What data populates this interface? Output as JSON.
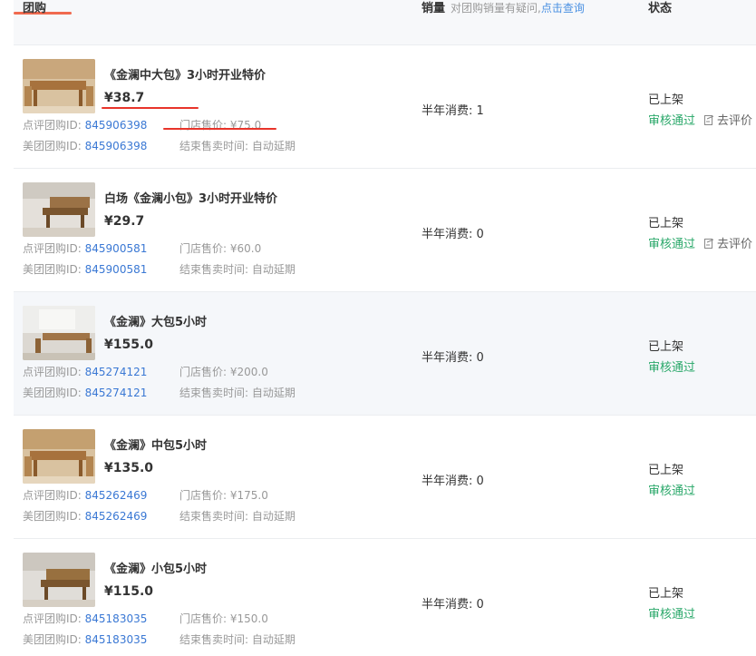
{
  "header": {
    "deal_label": "团购",
    "sales_label": "销量",
    "sales_hint": "对团购销量有疑问,",
    "sales_hint_link": "点击查询",
    "status_label": "状态"
  },
  "labels": {
    "dianping_id": "点评团购ID: ",
    "meituan_id": "美团团购ID: ",
    "store_price": "门店售价: ",
    "end_time": "结束售卖时间: ",
    "half_year": "半年消费: "
  },
  "rows": [
    {
      "title": "《金澜中大包》3小时开业特价",
      "price": "¥38.7",
      "dianping_id": "845906398",
      "meituan_id": "845906398",
      "store_price": "¥75.0",
      "end_time": "自动延期",
      "sales": "1",
      "status": "已上架",
      "review_status": "审核通过",
      "review_action": "去评价"
    },
    {
      "title": "白场《金澜小包》3小时开业特价",
      "price": "¥29.7",
      "dianping_id": "845900581",
      "meituan_id": "845900581",
      "store_price": "¥60.0",
      "end_time": "自动延期",
      "sales": "0",
      "status": "已上架",
      "review_status": "审核通过",
      "review_action": "去评价"
    },
    {
      "title": "《金澜》大包5小时",
      "price": "¥155.0",
      "dianping_id": "845274121",
      "meituan_id": "845274121",
      "store_price": "¥200.0",
      "end_time": "自动延期",
      "sales": "0",
      "status": "已上架",
      "review_status": "审核通过"
    },
    {
      "title": "《金澜》中包5小时",
      "price": "¥135.0",
      "dianping_id": "845262469",
      "meituan_id": "845262469",
      "store_price": "¥175.0",
      "end_time": "自动延期",
      "sales": "0",
      "status": "已上架",
      "review_status": "审核通过"
    },
    {
      "title": "《金澜》小包5小时",
      "price": "¥115.0",
      "dianping_id": "845183035",
      "meituan_id": "845183035",
      "store_price": "¥150.0",
      "end_time": "自动延期",
      "sales": "0",
      "status": "已上架",
      "review_status": "审核通过"
    }
  ],
  "colors": {
    "id_link": "#3a78d4",
    "approved": "#2aa86a",
    "annotation": "#e8342a",
    "tab_accent": "#f06a4f"
  }
}
